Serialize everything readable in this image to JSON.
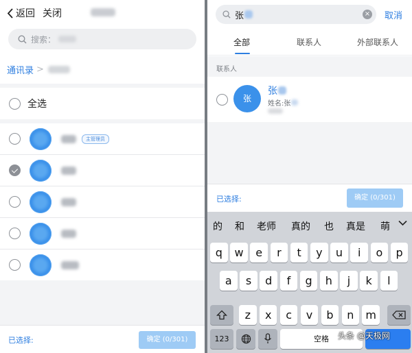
{
  "left": {
    "back_label": "返回",
    "close_label": "关闭",
    "search_placeholder": "搜索：",
    "breadcrumb_root": "通讯录",
    "breadcrumb_sep": ">",
    "select_all_label": "全选",
    "admin_badge": "主管理员",
    "contacts": [
      {
        "checked": false
      },
      {
        "checked": true
      },
      {
        "checked": false
      },
      {
        "checked": false
      },
      {
        "checked": false
      }
    ],
    "footer_label": "已选择:",
    "confirm_label": "确定 (0/301)"
  },
  "right": {
    "search_query": "张",
    "cancel_label": "取消",
    "tabs": [
      "全部",
      "联系人",
      "外部联系人"
    ],
    "section_label": "联系人",
    "result": {
      "avatar_text": "张",
      "name": "张",
      "subtitle": "姓名:张"
    },
    "footer_label": "已选择:",
    "confirm_label": "确定 (0/301)"
  },
  "keyboard": {
    "candidates": [
      "的",
      "和",
      "老师",
      "真的",
      "也",
      "真是",
      "萌"
    ],
    "row1": [
      "q",
      "w",
      "e",
      "r",
      "t",
      "y",
      "u",
      "i",
      "o",
      "p"
    ],
    "row2": [
      "a",
      "s",
      "d",
      "f",
      "g",
      "h",
      "j",
      "k",
      "l"
    ],
    "row3": [
      "z",
      "x",
      "c",
      "v",
      "b",
      "n",
      "m"
    ],
    "numbers_key": "123",
    "space_key": "空格",
    "watermark": "头条 @天极网"
  },
  "colors": {
    "accent": "#2d7ee0",
    "avatar": "#3b91ea",
    "confirm_disabled": "#9ecbf5",
    "keyboard_bg": "#d1d4d9"
  }
}
